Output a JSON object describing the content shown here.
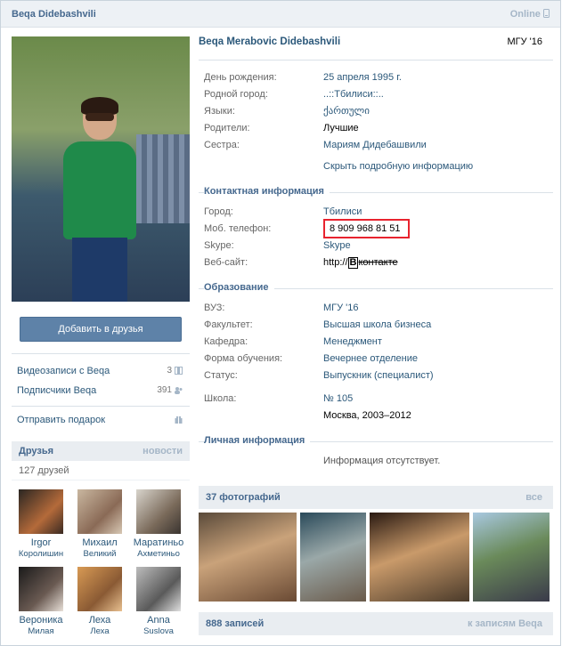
{
  "header": {
    "name": "Beqa Didebashvili",
    "status": "Online"
  },
  "sidebar": {
    "add_friend": "Добавить в друзья",
    "videos": {
      "label": "Видеозаписи с Beqa",
      "count": "3"
    },
    "followers": {
      "label": "Подписчики Beqa",
      "count": "391"
    },
    "gift": "Отправить подарок",
    "friends": {
      "title": "Друзья",
      "news": "новости",
      "count": "127 друзей",
      "items": [
        {
          "first": "Irgor",
          "last": "Королишин"
        },
        {
          "first": "Михаил",
          "last": "Великий"
        },
        {
          "first": "Маратиньо",
          "last": "Ахметиньо"
        },
        {
          "first": "Вероника",
          "last": "Милая"
        },
        {
          "first": "Леха",
          "last": "Леха"
        },
        {
          "first": "Anna",
          "last": "Suslova"
        }
      ]
    }
  },
  "profile": {
    "full_name": "Beqa Merabovic Didebashvili",
    "university": "МГУ '16",
    "basic": [
      {
        "k": "День рождения:",
        "v": "25 апреля 1995 г."
      },
      {
        "k": "Родной город:",
        "v": "..::Тбилиси::.."
      },
      {
        "k": "Языки:",
        "v": "ქართული"
      },
      {
        "k": "Родители:",
        "v": "Лучшие",
        "dark": true
      },
      {
        "k": "Сестра:",
        "v": "Мариям Дидебашвили"
      }
    ],
    "hide_more": "Скрыть подробную информацию",
    "contacts_title": "Контактная информация",
    "city": {
      "k": "Город:",
      "v": "Тбилиси"
    },
    "phone": {
      "k": "Моб. телефон:",
      "v": "8 909 968 81 51"
    },
    "skype": {
      "k": "Skype:",
      "v": "Skype"
    },
    "website": {
      "k": "Веб-сайт:",
      "v": "http://",
      "brand": "В",
      "brand_text": "контакте"
    },
    "education_title": "Образование",
    "education": [
      {
        "k": "ВУЗ:",
        "v": "МГУ '16"
      },
      {
        "k": "Факультет:",
        "v": "Высшая школа бизнеса"
      },
      {
        "k": "Кафедра:",
        "v": "Менеджмент"
      },
      {
        "k": "Форма обучения:",
        "v": "Вечернее отделение"
      },
      {
        "k": "Статус:",
        "v": "Выпускник (специалист)"
      }
    ],
    "school": {
      "k": "Школа:",
      "v": "№ 105",
      "v2": "Москва, 2003–2012"
    },
    "personal_title": "Личная информация",
    "personal_empty": "Информация отсутствует."
  },
  "photos": {
    "title": "37 фотографий",
    "all": "все"
  },
  "records": {
    "title": "888 записей",
    "link": "к записям Beqa"
  }
}
